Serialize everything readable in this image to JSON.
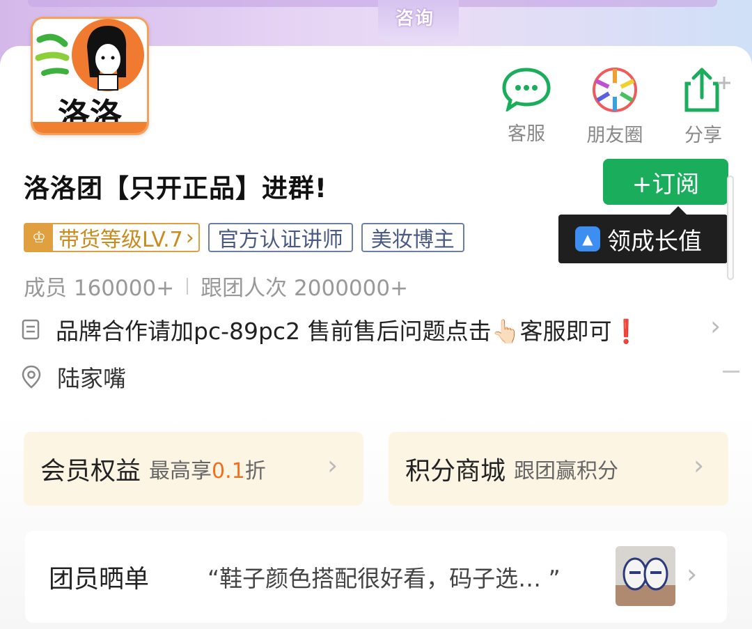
{
  "banner": {
    "label": "咨询"
  },
  "group": {
    "logo_text": "洛洛",
    "title": "洛洛团【只开正品】进群!",
    "subscribe_label": "+订阅",
    "tooltip": "领成长值"
  },
  "actions": [
    {
      "label": "客服",
      "icon": "chat-bubble-icon"
    },
    {
      "label": "朋友圈",
      "icon": "moments-icon"
    },
    {
      "label": "分享",
      "icon": "share-icon"
    }
  ],
  "tags": {
    "level": "带货等级LV.7",
    "cert": "官方认证讲师",
    "blogger": "美妆博主"
  },
  "stats": {
    "members": "成员 160000+",
    "visits": "跟团人次 2000000+"
  },
  "notice": {
    "text": "品牌合作请加pc-89pc2 售前售后问题点击👆🏻客服即可❗"
  },
  "location": {
    "text": "陆家嘴"
  },
  "benefits": [
    {
      "title": "会员权益",
      "sub_prefix": "最高享",
      "sub_accent": "0.1",
      "sub_suffix": "折"
    },
    {
      "title": "积分商城",
      "sub": "跟团赢积分"
    }
  ],
  "showcase": {
    "title": "团员晒单",
    "quote": "“鞋子颜色搭配很好看，码子选…  ”"
  },
  "colors": {
    "brand_green": "#1aad5b",
    "accent_orange": "#f07020",
    "level_gold": "#e0a040"
  }
}
